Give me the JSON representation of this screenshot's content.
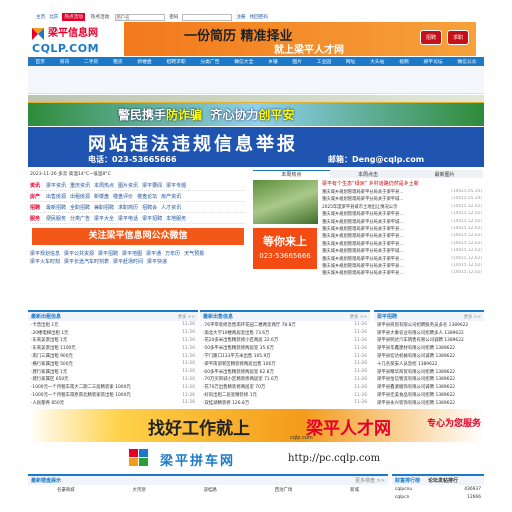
{
  "topbar": {
    "home": "主页",
    "region": "北京",
    "tabs": [
      "热点活动",
      "热点活动"
    ],
    "search_placeholder": "用户名",
    "search_btn": "密码",
    "register": "注册",
    "forgot": "找回密码"
  },
  "logo": {
    "name": "梁平信息网",
    "domain": "CQLP.COM"
  },
  "header_banner": {
    "slogan1": "一份简历 精准择业",
    "slogan2": "就上梁平人才网",
    "btn_hire": "招聘",
    "btn_job": "求职"
  },
  "nav": [
    "首页",
    "资讯",
    "二手房",
    "租房",
    "新楼盘",
    "招聘求职",
    "分类广告",
    "微信大全",
    "乡镇",
    "图片",
    "工业园",
    "网址",
    "大头站",
    "视频",
    "梁平论坛",
    "微信公众"
  ],
  "banner_police": {
    "text_a": "警民携手",
    "text_b": "防诈骗",
    "text_c": "齐心协力",
    "text_d": "创平安"
  },
  "banner_report": {
    "title": "网站违法违规信息举报",
    "phone": "电话：023-53665666",
    "email": "邮箱：Deng@cqlp.com"
  },
  "weather": "2023-11-26 多云 高温14°C~低温8°C",
  "left_rows": [
    {
      "cat": "资讯",
      "links": [
        "梁平资讯",
        "重庆资讯",
        "本周热点",
        "图片资讯",
        "梁平要闻",
        "梁平专题"
      ]
    },
    {
      "cat": "房产",
      "links": [
        "出售房源",
        "出租房源",
        "新楼盘",
        "楼盘评价",
        "楼盘论坛",
        "房产资讯"
      ]
    },
    {
      "cat": "招聘",
      "links": [
        "最新招聘",
        "全职招聘",
        "兼职招聘",
        "求职简历",
        "招聘会",
        "人才资讯"
      ]
    },
    {
      "cat": "服务",
      "links": [
        "便民服务",
        "分类广告",
        "梁平大全",
        "梁平电话",
        "梁平招聘",
        "本地服务"
      ]
    },
    {
      "cat": "微信",
      "links": [
        "梁平论坛",
        "梁平大全",
        "梁平号码",
        "梁平二手",
        "积分商城",
        "梁平QQ群大全"
      ]
    }
  ],
  "wechat_banner": "关注梁平信息网公众微信",
  "ad_wait": {
    "a": "等你来上",
    "b": "023-53665666"
  },
  "extra_links": [
    [
      "梁平规划信息",
      "梁平公共资源",
      "梁平招聘",
      "梁平地图",
      "梁平通",
      "万年历",
      "天气预报"
    ],
    [
      "梁平火车时刻",
      "梁平长途汽车时刻表",
      "梁平赶场时间",
      "梁平快递"
    ]
  ],
  "tabs2": [
    "本周热点",
    "本周点击",
    "最新图片"
  ],
  "top_news": "梁平有个生态“绿洲” 乡村道路仍然是乡土新",
  "news": [
    {
      "t": "重庆城乡规划管理局梁平分局关于梁平县...",
      "d": "(10015.05.20)"
    },
    {
      "t": "重庆城乡规划管理局梁平分局关于梁平城...",
      "d": "(10015.05.20)"
    },
    {
      "t": "2025年度梁平县城市土地出让情况公示",
      "d": "(10015.12.02)"
    },
    {
      "t": "重庆城乡规划管理局梁平分局关于梁平县...",
      "d": "(10015.12.02)"
    },
    {
      "t": "重庆城乡规划管理局梁平分局关于梁平城...",
      "d": "(10015.12.02)"
    },
    {
      "t": "重庆城乡规划管理局梁平分局关于梁平县...",
      "d": "(10015.12.02)"
    },
    {
      "t": "重庆城乡规划管理局梁平分局关于梁平县...",
      "d": "(10015.12.02)"
    },
    {
      "t": "重庆城乡规划管理局梁平分局关于梁平县...",
      "d": "(10015.12.02)"
    },
    {
      "t": "重庆城乡规划管理局梁平分局关于梁平城...",
      "d": "(10015.12.02)"
    },
    {
      "t": "重庆城乡规划管理局梁平分局关于梁平县...",
      "d": "(10015.12.02)"
    },
    {
      "t": "重庆城乡规划管理局梁平分局关于梁平县...",
      "d": "(10015.12.02)"
    },
    {
      "t": "重庆城乡规划管理局梁平分局关于梁平县...",
      "d": "(10015.12.02)"
    }
  ],
  "col1": {
    "title": "最新出租信息",
    "more": "更多 >>",
    "items": [
      {
        "t": "·卡普出租 1元",
        "d": "11-26"
      },
      {
        "t": "·20楼电梯出租 1元",
        "d": "11-26"
      },
      {
        "t": "·东来美景出租 1元",
        "d": "11-26"
      },
      {
        "t": "·东来美景出租 1100元",
        "d": "11-26"
      },
      {
        "t": "·南门三属出租 900元",
        "d": "11-26"
      },
      {
        "t": "·横行家属出租 500元",
        "d": "11-26"
      },
      {
        "t": "·建行家属出租 1元",
        "d": "11-26"
      },
      {
        "t": "·建行家属区 650元",
        "d": "11-26"
      },
      {
        "t": "·1000元一个月租车南大二期二三居精装家 1000元",
        "d": "11-26"
      },
      {
        "t": "·1000元一个月租车南原南北精装家装出租 1000元",
        "d": "11-26"
      },
      {
        "t": "·人民都养 850元",
        "d": "11-26"
      }
    ]
  },
  "col2": {
    "title": "最新出售信息",
    "more": "更多 >>",
    "items": [
      {
        "t": "·76平带装修急售南环花园二楼两室两厅 78.8万",
        "d": "11-26"
      },
      {
        "t": "·渝北大学10楼两居室出售 73.6万",
        "d": "11-26"
      },
      {
        "t": "·花20多米出售精装修小区两居 22.6万",
        "d": "11-26"
      },
      {
        "t": "·50多平米出售精装修两居室 35.6万",
        "d": "11-26"
      },
      {
        "t": "·学门路口133平方米出售 105.9万",
        "d": "11-26"
      },
      {
        "t": "·梁平南部新区精装修两居出售 106万",
        "d": "11-26"
      },
      {
        "t": "·60多平米出售精装修两居室 62.8万",
        "d": "11-26"
      },
      {
        "t": "·70万买新城小区精装修两居室 71.6万",
        "d": "11-26"
      },
      {
        "t": "·花70万出售精装修两居室 70万",
        "d": "11-26"
      },
      {
        "t": "·好房出租二居室精装修 1元",
        "d": "11-26"
      },
      {
        "t": "·双桂湖精装修 126.8万",
        "d": "11-26"
      }
    ]
  },
  "col3": {
    "title": "梁平招聘",
    "more": "更多 >>",
    "items": [
      {
        "t": "梁平县商贸有限公司招聘服务员多名 1389622"
      },
      {
        "t": "梁平县大乘农业有限公司招聘多人 1389622"
      },
      {
        "t": "梁平县明达汽车销售有限公司诚聘 1389622"
      },
      {
        "t": "梁平县华鑫建材有限公司招聘 1389622"
      },
      {
        "t": "梁平县宏达机械有限公司诚聘 1389622"
      },
      {
        "t": "十几名保安人员急招 1389622"
      },
      {
        "t": "梁平县精华商贸有限公司招聘 1389622"
      },
      {
        "t": "梁平县恒信物流有限公司招聘 1389622"
      },
      {
        "t": "梁平县鑫源服饰有限公司诚聘 1389622"
      },
      {
        "t": "梁平县佳美食品有限公司招聘 1389622"
      },
      {
        "t": "梁平县永兴装饰有限公司招聘 1389622"
      }
    ]
  },
  "job_banner": {
    "a": "找好工作就上",
    "b": "梁平人才网",
    "c": "cqlp.com",
    "d": "专心为您服务"
  },
  "carpool": {
    "name": "梁平拼车网",
    "url": "http://pc.cqlp.com"
  },
  "bottom_left": {
    "title": "最新楼盘展示",
    "more": "更多楼盘 >>",
    "cols": [
      "名豪商城",
      "大河坝",
      "双桂路",
      "西池广场",
      "新城"
    ]
  },
  "bottom_right": {
    "tabs": [
      "财富排行榜",
      "论坛发帖排行"
    ],
    "items": [
      {
        "n": "cqlpcnu",
        "v": "436937"
      },
      {
        "n": "cqlpcn",
        "v": "12666"
      }
    ]
  }
}
